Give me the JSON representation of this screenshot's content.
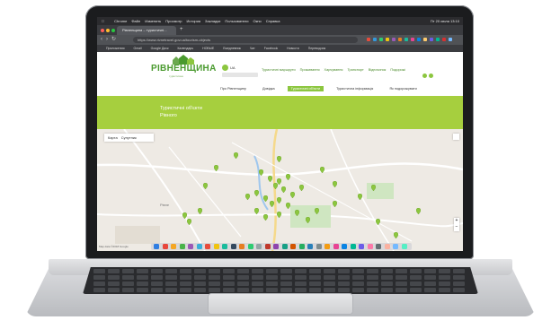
{
  "browser": {
    "menubar_items": [
      "Chrome",
      "Файл",
      "Изменить",
      "Просмотр",
      "История",
      "Закладки",
      "Пользователи",
      "Окно",
      "Справка"
    ],
    "clock": "Пт 20 июля 13:10",
    "tab_title": "Рівненщина – туристичні...",
    "address": "https://www.rivnetravel.gov.ua/tourism-objects",
    "bookmarks": [
      "Приложения",
      "Gmail",
      "Google Диск",
      "Календарь",
      "НОВЫЕ",
      "Ежедневник",
      "Чат",
      "Facebook",
      "Новости",
      "Переводчик"
    ]
  },
  "site": {
    "logo_text": "РІВНЕНЩИНА",
    "logo_subtitle": "туристична",
    "language": "UA",
    "top_nav": [
      "Туристичні маршрути",
      "Проживання",
      "Харчування",
      "Транспорт",
      "Відпочинок",
      "Подорожі"
    ],
    "main_nav": [
      "Про Рівненщину",
      "Довідка",
      "Туристичні об'єкти",
      "Туристична інформація",
      "Як подорожувати"
    ],
    "main_nav_active_index": 2,
    "banner_title": [
      "Туристичні об'єкти",
      "Рівного"
    ],
    "accent_color": "#8cc63f",
    "banner_color": "#a6cf3e"
  },
  "map": {
    "tabs": [
      "Карта",
      "Супутник"
    ],
    "active_tab": "Карта",
    "city_label": "Рівне",
    "copyright": "Map data ©2018 Google",
    "pin_color": "#8cc63f",
    "fullscreen_icon": "fullscreen-icon",
    "zoom_icons": [
      "zoom-in-icon",
      "zoom-out-icon"
    ]
  },
  "dock_colors": [
    "#2f7de1",
    "#e8473c",
    "#f5a623",
    "#4ab34a",
    "#9b59b6",
    "#3bb0d8",
    "#e74c3c",
    "#f1c40f",
    "#1abc9c",
    "#34495e",
    "#e67e22",
    "#2ecc71",
    "#95a5a6",
    "#c0392b",
    "#8e44ad",
    "#16a085",
    "#d35400",
    "#27ae60",
    "#2980b9",
    "#7f8c8d",
    "#f39c12",
    "#e84393",
    "#0984e3",
    "#00b894",
    "#6c5ce7",
    "#fd79a8",
    "#636e72",
    "#fab1a0",
    "#74b9ff",
    "#55efc4"
  ]
}
